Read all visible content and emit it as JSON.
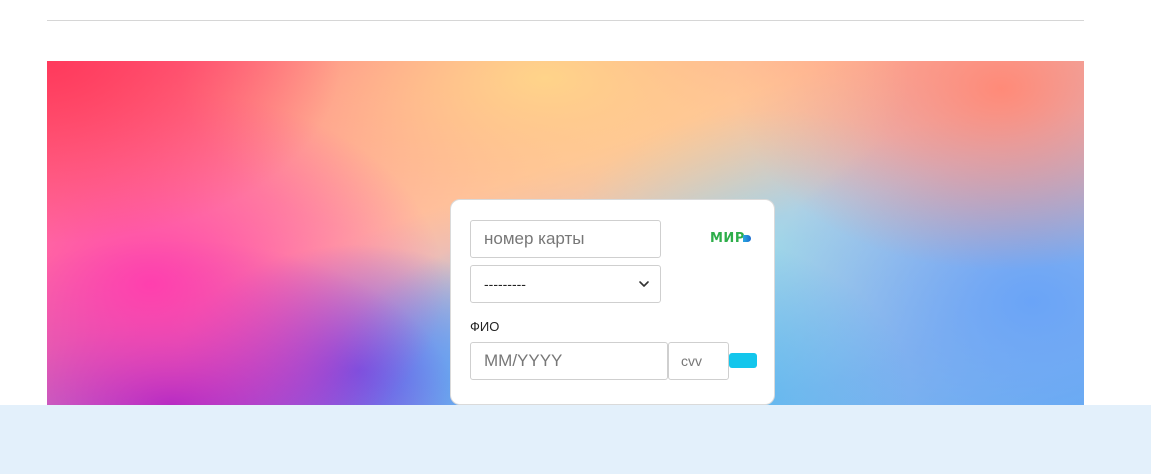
{
  "form": {
    "card_number_placeholder": "номер карты",
    "select_value": "---------",
    "fio_label": "ФИО",
    "expiry_placeholder": "MM/YYYY",
    "cvv_placeholder": "cvv",
    "brand_logo": "МИР",
    "submit_color": "#13c6ec"
  },
  "colors": {
    "accent": "#13c6ec",
    "footer": "#e3f0fb",
    "mir_green": "#2eae4a"
  }
}
